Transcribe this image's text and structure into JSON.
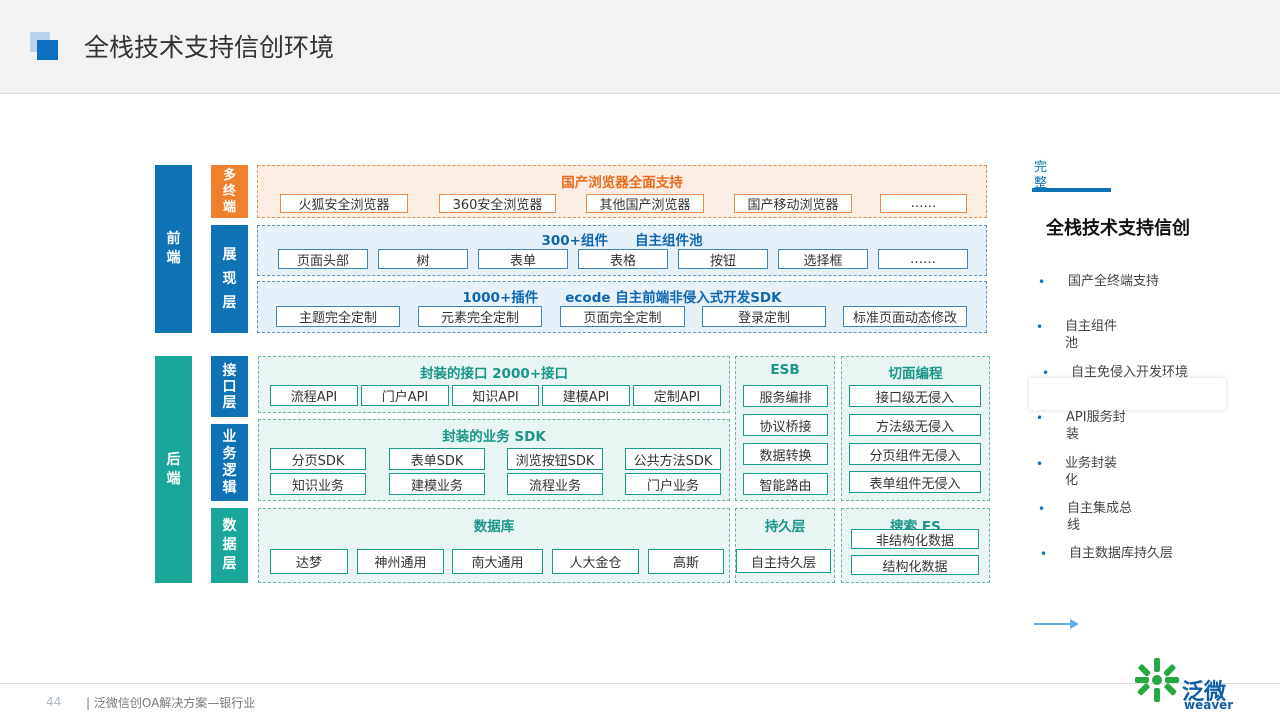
{
  "title": "全栈技术支持信创环境",
  "frontend_label": "前端",
  "backend_label": "后端",
  "layers": {
    "multi_terminal": "多终端",
    "display": "展现层",
    "interface": "接口层",
    "business_logic": "业务逻辑",
    "data": "数据层"
  },
  "browser": {
    "title": "国产浏览器全面支持",
    "items": [
      "火狐安全浏览器",
      "360安全浏览器",
      "其他国产浏览器",
      "国产移动浏览器",
      "……"
    ]
  },
  "components": {
    "title": "300+组件　　自主组件池",
    "items": [
      "页面头部",
      "树",
      "表单",
      "表格",
      "按钮",
      "选择框",
      "……"
    ]
  },
  "plugins": {
    "title": "1000+插件　　ecode  自主前端非侵入式开发SDK",
    "items": [
      "主题完全定制",
      "元素完全定制",
      "页面完全定制",
      "登录定制",
      "标准页面动态修改"
    ]
  },
  "interfaces": {
    "title": "封装的接口  2000+接口",
    "items": [
      "流程API",
      "门户API",
      "知识API",
      "建模API",
      "定制API"
    ]
  },
  "sdk": {
    "title": "封装的业务 SDK",
    "row1": [
      "分页SDK",
      "表单SDK",
      "浏览按钮SDK",
      "公共方法SDK"
    ],
    "row2": [
      "知识业务",
      "建模业务",
      "流程业务",
      "门户业务"
    ]
  },
  "database": {
    "title": "数据库",
    "items": [
      "达梦",
      "神州通用",
      "南大通用",
      "人大金仓",
      "高斯"
    ]
  },
  "esb": {
    "title": "ESB",
    "items": [
      "服务编排",
      "协议桥接",
      "数据转换",
      "智能路由"
    ]
  },
  "aop": {
    "title": "切面编程",
    "items": [
      "接口级无侵入",
      "方法级无侵入",
      "分页组件无侵入",
      "表单组件无侵入"
    ]
  },
  "persistence": {
    "title": "持久层",
    "items": [
      "自主持久层"
    ]
  },
  "search": {
    "title": "搜索 ES",
    "items": [
      "非结构化数据",
      "结构化数据"
    ]
  },
  "sidebar": {
    "tab_label": "完整",
    "heading": "全栈技术支持信创",
    "items": [
      "国产全终端支持",
      "自主组件池",
      "自主免侵入开发环境",
      "API服务封装",
      "业务封装化",
      "自主集成总线",
      "自主数据库持久层"
    ]
  },
  "footer": {
    "page_number": "44",
    "text": "|  泛微信创OA解决方案—银行业",
    "logo_text": "泛微",
    "logo_sub": "weaver"
  },
  "colors": {
    "blue": "#0e72b5",
    "orange": "#f07f2e",
    "teal": "#1aa79a"
  }
}
